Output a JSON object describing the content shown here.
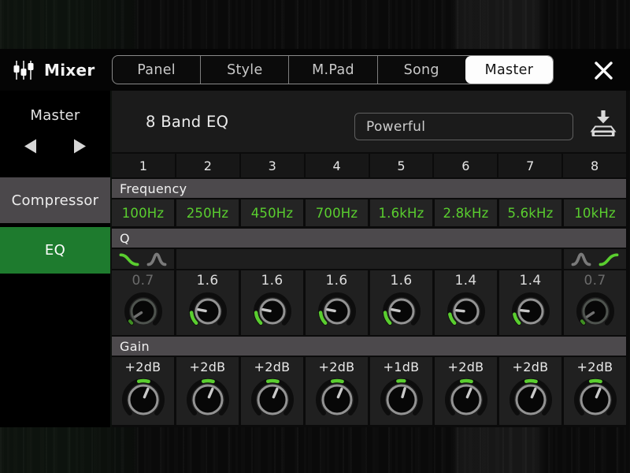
{
  "app": {
    "title": "Mixer"
  },
  "tabs": [
    {
      "label": "Panel",
      "active": false
    },
    {
      "label": "Style",
      "active": false
    },
    {
      "label": "M.Pad",
      "active": false
    },
    {
      "label": "Song",
      "active": false
    },
    {
      "label": "Master",
      "active": true
    }
  ],
  "sidebar": {
    "selector_label": "Master",
    "items": [
      {
        "label": "Compressor",
        "active": false
      },
      {
        "label": "EQ",
        "active": true
      }
    ]
  },
  "main": {
    "title": "8 Band EQ",
    "preset_value": "Powerful",
    "band_numbers": [
      "1",
      "2",
      "3",
      "4",
      "5",
      "6",
      "7",
      "8"
    ],
    "frequency": {
      "label": "Frequency",
      "values": [
        "100Hz",
        "250Hz",
        "450Hz",
        "700Hz",
        "1.6kHz",
        "2.8kHz",
        "5.6kHz",
        "10kHz"
      ]
    },
    "q": {
      "label": "Q",
      "values": [
        "0.7",
        "1.6",
        "1.6",
        "1.6",
        "1.6",
        "1.4",
        "1.4",
        "0.7"
      ],
      "dimmed": [
        true,
        false,
        false,
        false,
        false,
        false,
        false,
        true
      ],
      "filter_type_icons": {
        "band1": [
          {
            "icon": "shelf-falling",
            "active": true
          },
          {
            "icon": "peak",
            "active": false
          }
        ],
        "band8": [
          {
            "icon": "peak",
            "active": false
          },
          {
            "icon": "shelf-rising",
            "active": true
          }
        ]
      }
    },
    "gain": {
      "label": "Gain",
      "values": [
        "+2dB",
        "+2dB",
        "+2dB",
        "+2dB",
        "+1dB",
        "+2dB",
        "+2dB",
        "+2dB"
      ]
    }
  },
  "colors": {
    "accent_green": "#5ace2f",
    "selected_item_green": "#1e7b2e",
    "header_row_gray": "#4c494c"
  }
}
